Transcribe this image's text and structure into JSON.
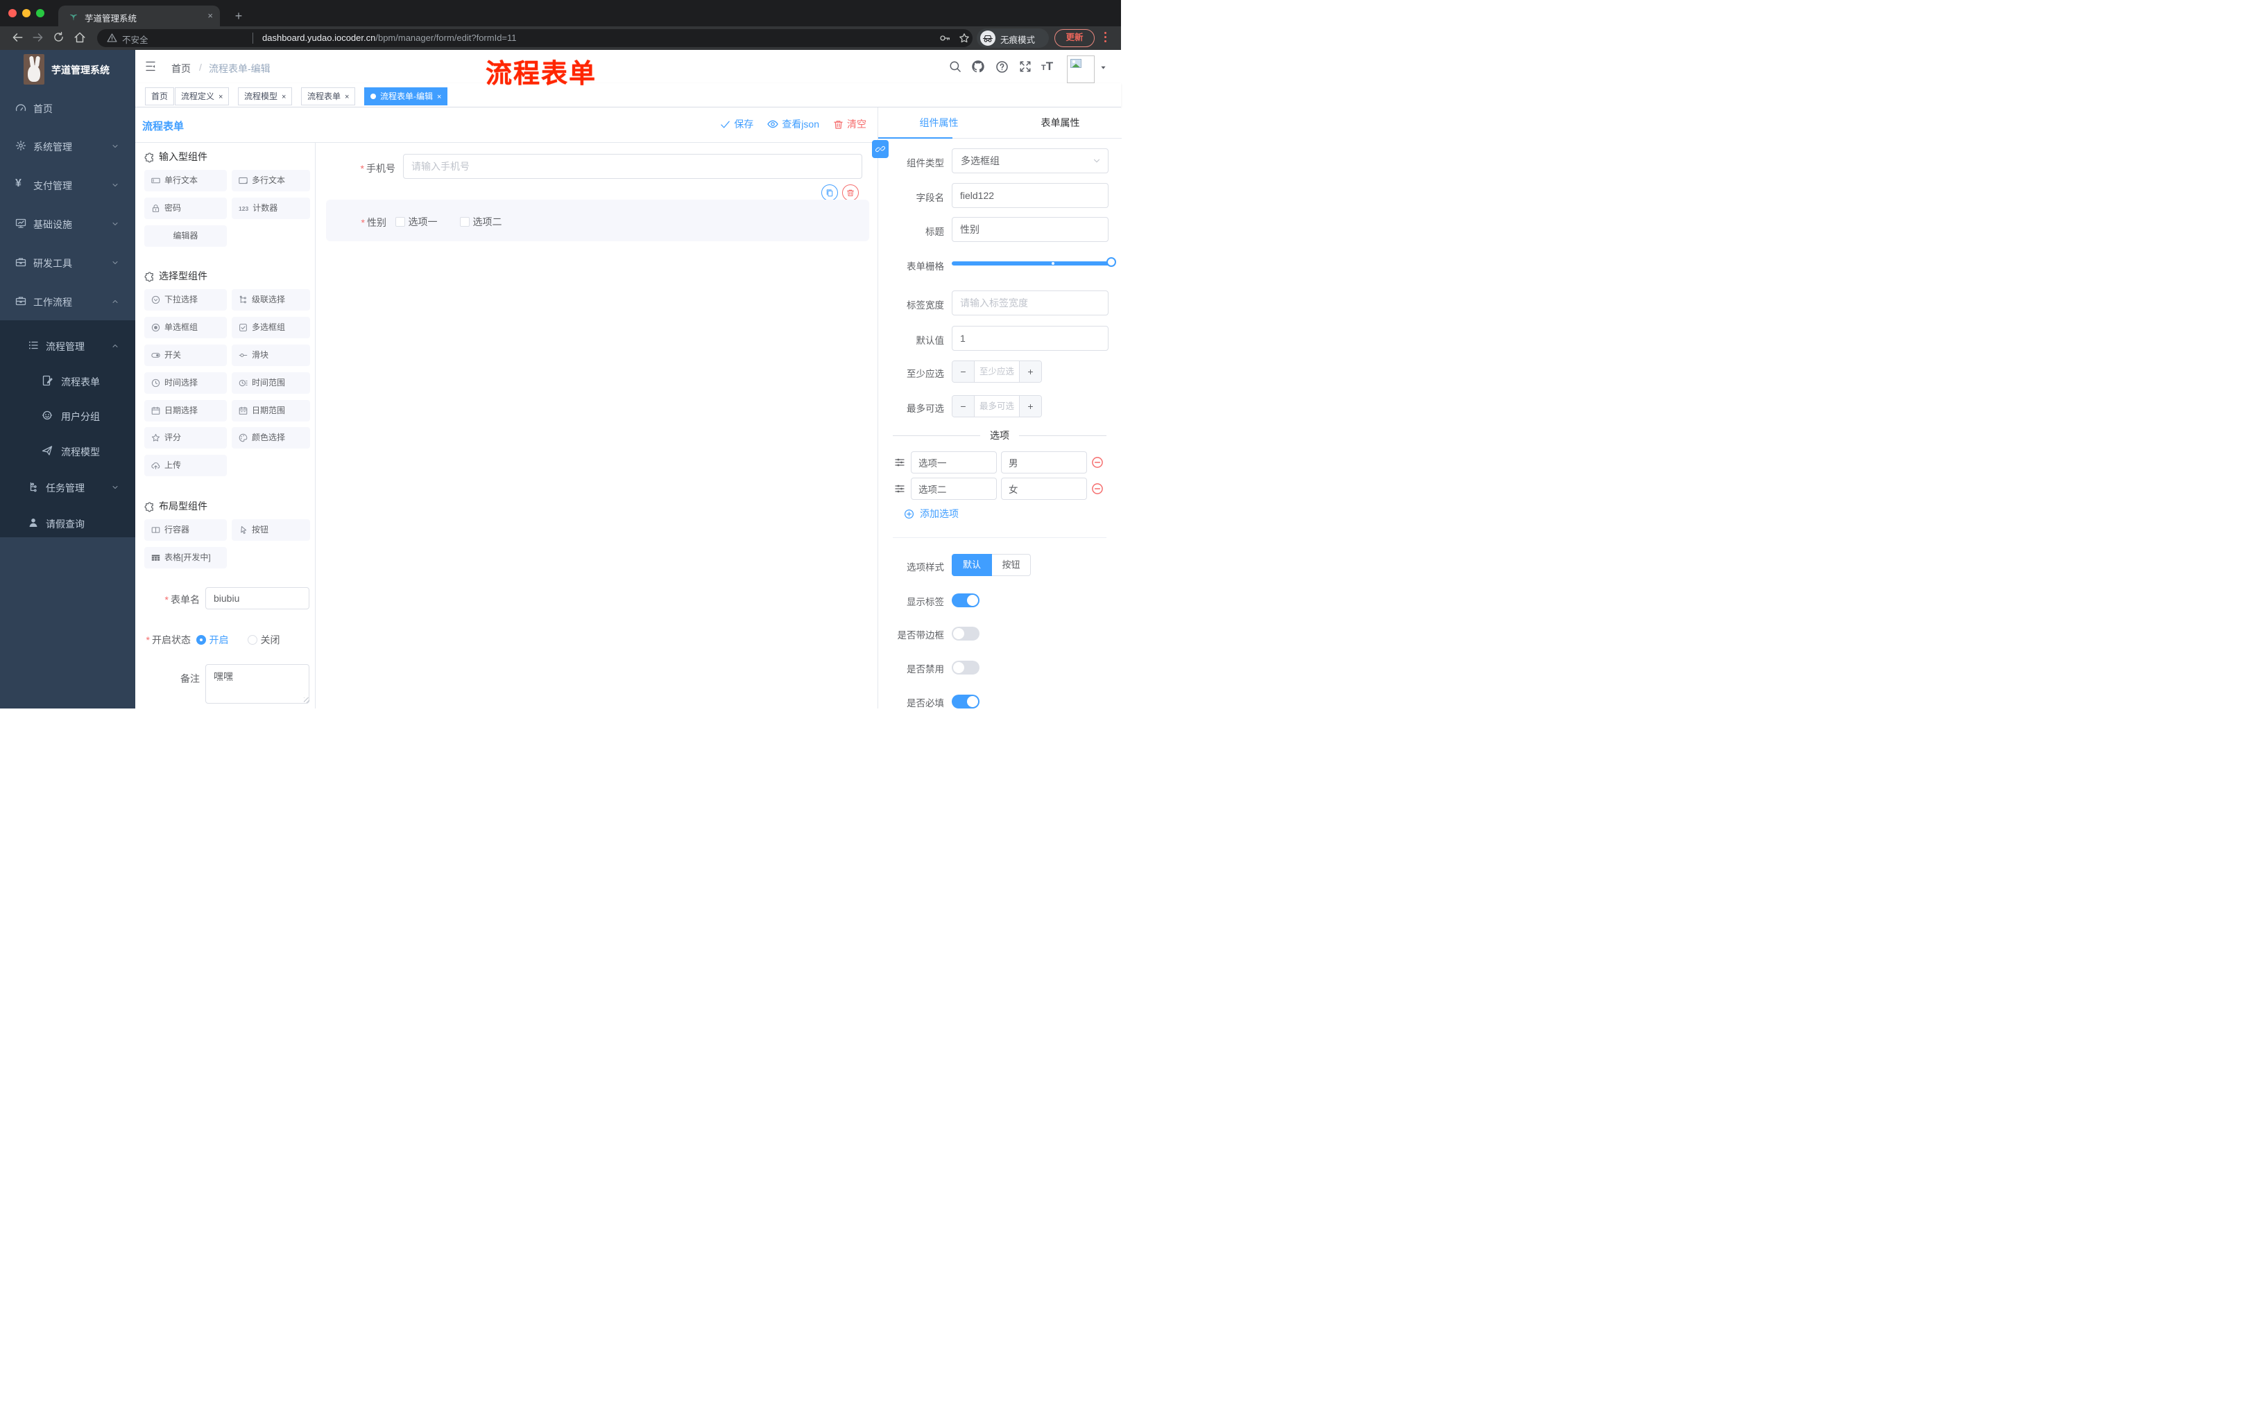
{
  "browser": {
    "tab_title": "芋道管理系统",
    "close_glyph": "×",
    "security_label": "不安全",
    "url_host": "dashboard.yudao.iocoder.cn",
    "url_path": "/bpm/manager/form/edit?formId=11",
    "incognito_label": "无痕模式",
    "update_label": "更新"
  },
  "sidebar": {
    "app_title": "芋道管理系统",
    "items": [
      {
        "label": "首页"
      },
      {
        "label": "系统管理"
      },
      {
        "label": "支付管理"
      },
      {
        "label": "基础设施"
      },
      {
        "label": "研发工具"
      },
      {
        "label": "工作流程"
      }
    ],
    "submenu": {
      "parent": "流程管理",
      "children": [
        "流程表单",
        "用户分组",
        "流程模型"
      ],
      "siblings": [
        {
          "label": "任务管理"
        },
        {
          "label": "请假查询"
        }
      ]
    }
  },
  "navbar": {
    "breadcrumb_home": "首页",
    "breadcrumb_sep": "/",
    "breadcrumb_current": "流程表单-编辑"
  },
  "annotation": {
    "text": "流程表单",
    "color": "#ff2600"
  },
  "tags": {
    "close_glyph": "×",
    "items": [
      {
        "label": "首页"
      },
      {
        "label": "流程定义"
      },
      {
        "label": "流程模型"
      },
      {
        "label": "流程表单"
      },
      {
        "label": "流程表单-编辑"
      }
    ]
  },
  "toolbar": {
    "title": "流程表单",
    "save": "保存",
    "view_json": "查看json",
    "clear": "清空"
  },
  "components": {
    "groups": [
      {
        "title": "输入型组件",
        "items": [
          "单行文本",
          "多行文本",
          "密码",
          "计数器",
          "编辑器"
        ]
      },
      {
        "title": "选择型组件",
        "items": [
          "下拉选择",
          "级联选择",
          "单选框组",
          "多选框组",
          "开关",
          "滑块",
          "时间选择",
          "时间范围",
          "日期选择",
          "日期范围",
          "评分",
          "颜色选择",
          "上传"
        ]
      },
      {
        "title": "布局型组件",
        "items": [
          "行容器",
          "按钮",
          "表格[开发中]"
        ]
      }
    ]
  },
  "form_meta": {
    "name_label": "表单名",
    "name_value": "biubiu",
    "status_label": "开启状态",
    "status_on": "开启",
    "status_off": "关闭",
    "status_selected": "开启",
    "remark_label": "备注",
    "remark_value": "嘿嘿"
  },
  "canvas": {
    "phone_label": "手机号",
    "phone_placeholder": "请输入手机号",
    "gender_label": "性别",
    "gender_option1": "选项一",
    "gender_option2": "选项二"
  },
  "panel": {
    "accent_color": "#409eff",
    "tab_component": "组件属性",
    "tab_form": "表单属性",
    "type_label": "组件类型",
    "type_value": "多选框组",
    "field_label": "字段名",
    "field_value": "field122",
    "title_label": "标题",
    "title_value": "性别",
    "grid_label": "表单栅格",
    "labelwidth_label": "标签宽度",
    "labelwidth_placeholder": "请输入标签宽度",
    "default_label": "默认值",
    "default_value": "1",
    "min_label": "至少应选",
    "min_placeholder": "至少应选",
    "max_label": "最多可选",
    "max_placeholder": "最多可选",
    "stepper_minus": "−",
    "stepper_plus": "+",
    "options_title": "选项",
    "options": [
      {
        "name": "选项一",
        "value": "男"
      },
      {
        "name": "选项二",
        "value": "女"
      }
    ],
    "add_option": "添加选项",
    "style_label": "选项样式",
    "style_default": "默认",
    "style_button": "按钮",
    "switch_show_label": "显示标签",
    "switch_border": "是否带边框",
    "switch_disabled": "是否禁用",
    "switch_required": "是否必填"
  }
}
